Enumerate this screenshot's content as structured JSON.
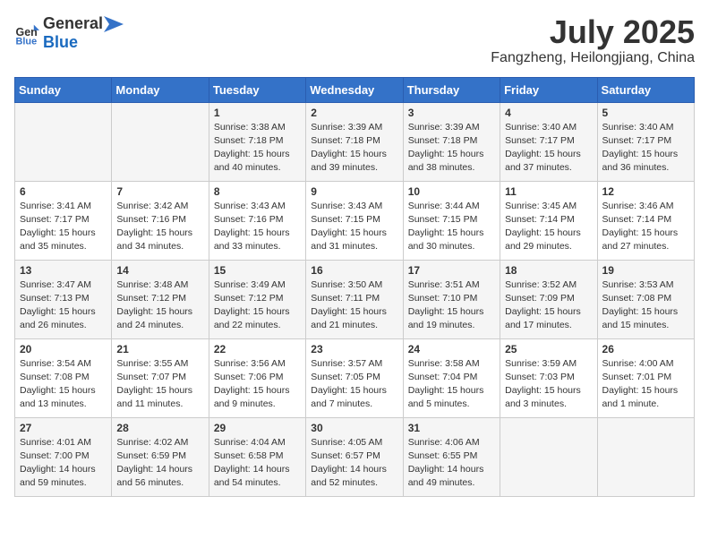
{
  "header": {
    "logo_general": "General",
    "logo_blue": "Blue",
    "month_title": "July 2025",
    "subtitle": "Fangzheng, Heilongjiang, China"
  },
  "days_of_week": [
    "Sunday",
    "Monday",
    "Tuesday",
    "Wednesday",
    "Thursday",
    "Friday",
    "Saturday"
  ],
  "weeks": [
    [
      {
        "day": "",
        "content": ""
      },
      {
        "day": "",
        "content": ""
      },
      {
        "day": "1",
        "content": "Sunrise: 3:38 AM\nSunset: 7:18 PM\nDaylight: 15 hours and 40 minutes."
      },
      {
        "day": "2",
        "content": "Sunrise: 3:39 AM\nSunset: 7:18 PM\nDaylight: 15 hours and 39 minutes."
      },
      {
        "day": "3",
        "content": "Sunrise: 3:39 AM\nSunset: 7:18 PM\nDaylight: 15 hours and 38 minutes."
      },
      {
        "day": "4",
        "content": "Sunrise: 3:40 AM\nSunset: 7:17 PM\nDaylight: 15 hours and 37 minutes."
      },
      {
        "day": "5",
        "content": "Sunrise: 3:40 AM\nSunset: 7:17 PM\nDaylight: 15 hours and 36 minutes."
      }
    ],
    [
      {
        "day": "6",
        "content": "Sunrise: 3:41 AM\nSunset: 7:17 PM\nDaylight: 15 hours and 35 minutes."
      },
      {
        "day": "7",
        "content": "Sunrise: 3:42 AM\nSunset: 7:16 PM\nDaylight: 15 hours and 34 minutes."
      },
      {
        "day": "8",
        "content": "Sunrise: 3:43 AM\nSunset: 7:16 PM\nDaylight: 15 hours and 33 minutes."
      },
      {
        "day": "9",
        "content": "Sunrise: 3:43 AM\nSunset: 7:15 PM\nDaylight: 15 hours and 31 minutes."
      },
      {
        "day": "10",
        "content": "Sunrise: 3:44 AM\nSunset: 7:15 PM\nDaylight: 15 hours and 30 minutes."
      },
      {
        "day": "11",
        "content": "Sunrise: 3:45 AM\nSunset: 7:14 PM\nDaylight: 15 hours and 29 minutes."
      },
      {
        "day": "12",
        "content": "Sunrise: 3:46 AM\nSunset: 7:14 PM\nDaylight: 15 hours and 27 minutes."
      }
    ],
    [
      {
        "day": "13",
        "content": "Sunrise: 3:47 AM\nSunset: 7:13 PM\nDaylight: 15 hours and 26 minutes."
      },
      {
        "day": "14",
        "content": "Sunrise: 3:48 AM\nSunset: 7:12 PM\nDaylight: 15 hours and 24 minutes."
      },
      {
        "day": "15",
        "content": "Sunrise: 3:49 AM\nSunset: 7:12 PM\nDaylight: 15 hours and 22 minutes."
      },
      {
        "day": "16",
        "content": "Sunrise: 3:50 AM\nSunset: 7:11 PM\nDaylight: 15 hours and 21 minutes."
      },
      {
        "day": "17",
        "content": "Sunrise: 3:51 AM\nSunset: 7:10 PM\nDaylight: 15 hours and 19 minutes."
      },
      {
        "day": "18",
        "content": "Sunrise: 3:52 AM\nSunset: 7:09 PM\nDaylight: 15 hours and 17 minutes."
      },
      {
        "day": "19",
        "content": "Sunrise: 3:53 AM\nSunset: 7:08 PM\nDaylight: 15 hours and 15 minutes."
      }
    ],
    [
      {
        "day": "20",
        "content": "Sunrise: 3:54 AM\nSunset: 7:08 PM\nDaylight: 15 hours and 13 minutes."
      },
      {
        "day": "21",
        "content": "Sunrise: 3:55 AM\nSunset: 7:07 PM\nDaylight: 15 hours and 11 minutes."
      },
      {
        "day": "22",
        "content": "Sunrise: 3:56 AM\nSunset: 7:06 PM\nDaylight: 15 hours and 9 minutes."
      },
      {
        "day": "23",
        "content": "Sunrise: 3:57 AM\nSunset: 7:05 PM\nDaylight: 15 hours and 7 minutes."
      },
      {
        "day": "24",
        "content": "Sunrise: 3:58 AM\nSunset: 7:04 PM\nDaylight: 15 hours and 5 minutes."
      },
      {
        "day": "25",
        "content": "Sunrise: 3:59 AM\nSunset: 7:03 PM\nDaylight: 15 hours and 3 minutes."
      },
      {
        "day": "26",
        "content": "Sunrise: 4:00 AM\nSunset: 7:01 PM\nDaylight: 15 hours and 1 minute."
      }
    ],
    [
      {
        "day": "27",
        "content": "Sunrise: 4:01 AM\nSunset: 7:00 PM\nDaylight: 14 hours and 59 minutes."
      },
      {
        "day": "28",
        "content": "Sunrise: 4:02 AM\nSunset: 6:59 PM\nDaylight: 14 hours and 56 minutes."
      },
      {
        "day": "29",
        "content": "Sunrise: 4:04 AM\nSunset: 6:58 PM\nDaylight: 14 hours and 54 minutes."
      },
      {
        "day": "30",
        "content": "Sunrise: 4:05 AM\nSunset: 6:57 PM\nDaylight: 14 hours and 52 minutes."
      },
      {
        "day": "31",
        "content": "Sunrise: 4:06 AM\nSunset: 6:55 PM\nDaylight: 14 hours and 49 minutes."
      },
      {
        "day": "",
        "content": ""
      },
      {
        "day": "",
        "content": ""
      }
    ]
  ]
}
